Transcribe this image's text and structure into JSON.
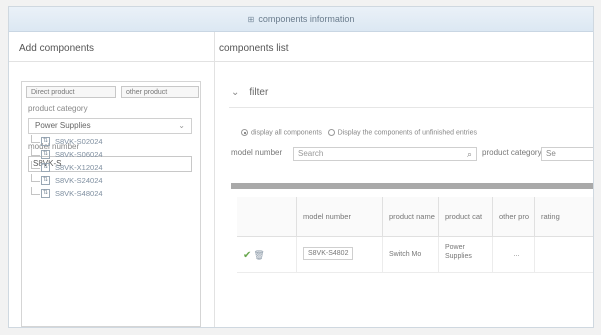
{
  "window": {
    "title": "components information"
  },
  "left": {
    "heading": "Add components",
    "tabs": [
      "Direct product",
      "other product"
    ],
    "category_label": "product category",
    "category_value": "Power Supplies",
    "model_label": "model number",
    "model_value": "S8VK-S",
    "tree": [
      "S8VK-S02024",
      "S8VK-S06024",
      "S8VK-X12024",
      "S8VK-S24024",
      "S8VK-S48024"
    ]
  },
  "right": {
    "heading": "components list",
    "filter_label": "filter",
    "radio_all": "display all components",
    "radio_unfinished": "Display the components of unfinished entries",
    "model_label": "model number",
    "search_placeholder": "Search",
    "category_label": "product category",
    "category_value": "Se",
    "columns": [
      "model number",
      "product name",
      "product cat",
      "other pro",
      "rating"
    ],
    "row": {
      "model": "S8VK-S4802",
      "name": "Switch Mo",
      "category": "Power Supplies",
      "other": "...",
      "rating": ""
    }
  }
}
